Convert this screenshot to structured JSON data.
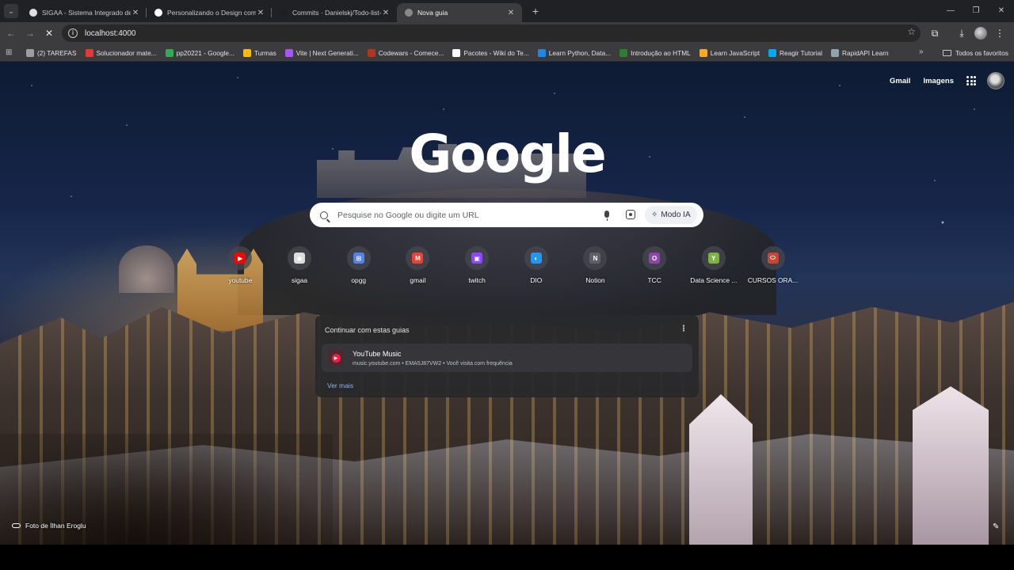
{
  "tabs": [
    {
      "title": "SIGAA - Sistema Integrado de G",
      "color": "#e0e0e0",
      "active": false
    },
    {
      "title": "Personalizando o Design com T",
      "color": "#ffffff",
      "active": false
    },
    {
      "title": "Commits · Danielskj/Todo-list-c",
      "color": "#1f1f1f",
      "active": false
    },
    {
      "title": "Nova guia",
      "color": "#888888",
      "active": true
    }
  ],
  "address": {
    "url": "localhost:4000"
  },
  "bookmarks": [
    {
      "label": "(2) TAREFAS",
      "color": "#9e9e9e"
    },
    {
      "label": "Solucionador mate...",
      "color": "#e53935"
    },
    {
      "label": "pp20221 - Google...",
      "color": "#34a853"
    },
    {
      "label": "Turmas",
      "color": "#fbbc04"
    },
    {
      "label": "Vite | Next Generati...",
      "color": "#a855f7"
    },
    {
      "label": "Codewars - Comece...",
      "color": "#b1361e"
    },
    {
      "label": "Pacotes - Wiki do Te...",
      "color": "#ffffff"
    },
    {
      "label": "Learn Python, Data...",
      "color": "#1e88e5"
    },
    {
      "label": "Introdução ao HTML",
      "color": "#2e7d32"
    },
    {
      "label": "Learn JavaScript",
      "color": "#f9a825"
    },
    {
      "label": "Reagir Tutorial",
      "color": "#03a9f4"
    },
    {
      "label": "RapidAPI Learn",
      "color": "#90a4ae"
    }
  ],
  "bookmarks_all": "Todos os favoritos",
  "header": {
    "gmail": "Gmail",
    "images": "Imagens"
  },
  "logo": "Google",
  "search": {
    "placeholder": "Pesquise no Google ou digite um URL",
    "ai_mode": "Modo IA"
  },
  "shortcuts": [
    {
      "label": "youtube",
      "color": "#ff0000",
      "icon": "▶"
    },
    {
      "label": "sigaa",
      "color": "#dddddd",
      "icon": "◉"
    },
    {
      "label": "opgg",
      "color": "#5383e8",
      "icon": "⊞"
    },
    {
      "label": "gmail",
      "color": "#ea4335",
      "icon": "M"
    },
    {
      "label": "twitch",
      "color": "#9146ff",
      "icon": "▣"
    },
    {
      "label": "DIO",
      "color": "#2196f3",
      "icon": "◐"
    },
    {
      "label": "Notion",
      "color": "#5f5f68",
      "icon": "N"
    },
    {
      "label": "TCC",
      "color": "#8e44ad",
      "icon": "O"
    },
    {
      "label": "Data Science ...",
      "color": "#7cb342",
      "icon": "Y"
    },
    {
      "label": "CURSOS ORA...",
      "color": "#c74634",
      "icon": "⬭"
    }
  ],
  "continue": {
    "title": "Continuar com estas guias",
    "item_title": "YouTube Music",
    "item_sub": "music.youtube.com • EMA5J87VW2 • Você visita com frequência",
    "more": "Ver mais"
  },
  "attribution": "Foto de İlhan Eroglu"
}
